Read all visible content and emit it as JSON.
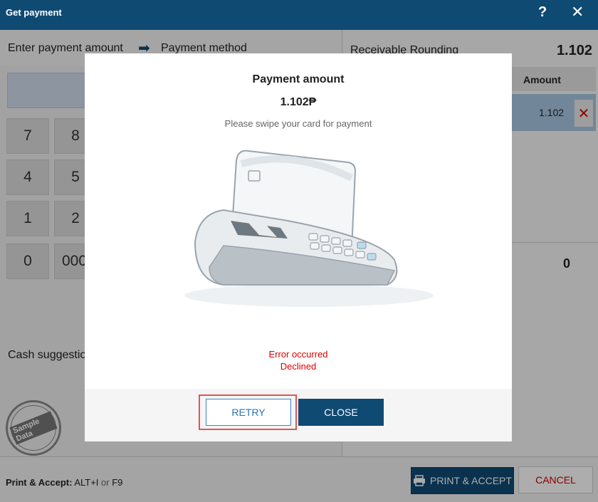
{
  "window": {
    "title": "Get payment",
    "help_glyph": "?",
    "close_glyph": "✕"
  },
  "steps": {
    "step1": "Enter payment amount",
    "arrow_glyph": "➡",
    "step2": "Payment method"
  },
  "keypad": {
    "keys": [
      "7",
      "8",
      "4",
      "5",
      "1",
      "2",
      "0",
      "000"
    ]
  },
  "cash_suggestions_label": "Cash suggestions",
  "stamp": {
    "text": "Sample Data"
  },
  "right_panel": {
    "receivable_label": "Receivable Rounding",
    "receivable_value": "1.102",
    "table_header_amount": "Amount",
    "rows": [
      {
        "amount": "1.102",
        "delete_glyph": "✕"
      }
    ],
    "change_value": "0"
  },
  "footer": {
    "hint_label": "Print & Accept:",
    "hint_keys1": "ALT+I",
    "hint_or": "or",
    "hint_keys2": "F9",
    "print_accept": "PRINT & ACCEPT",
    "cancel": "CANCEL"
  },
  "modal": {
    "title": "Payment amount",
    "amount": "1.102₱",
    "instruction": "Please swipe your card for payment",
    "error_line1": "Error occurred",
    "error_line2": "Declined",
    "retry": "RETRY",
    "close": "CLOSE"
  },
  "colors": {
    "primary": "#0f4a73",
    "error": "#dd0000",
    "selected_row": "#a9c6e2",
    "highlight": "#e05555"
  }
}
